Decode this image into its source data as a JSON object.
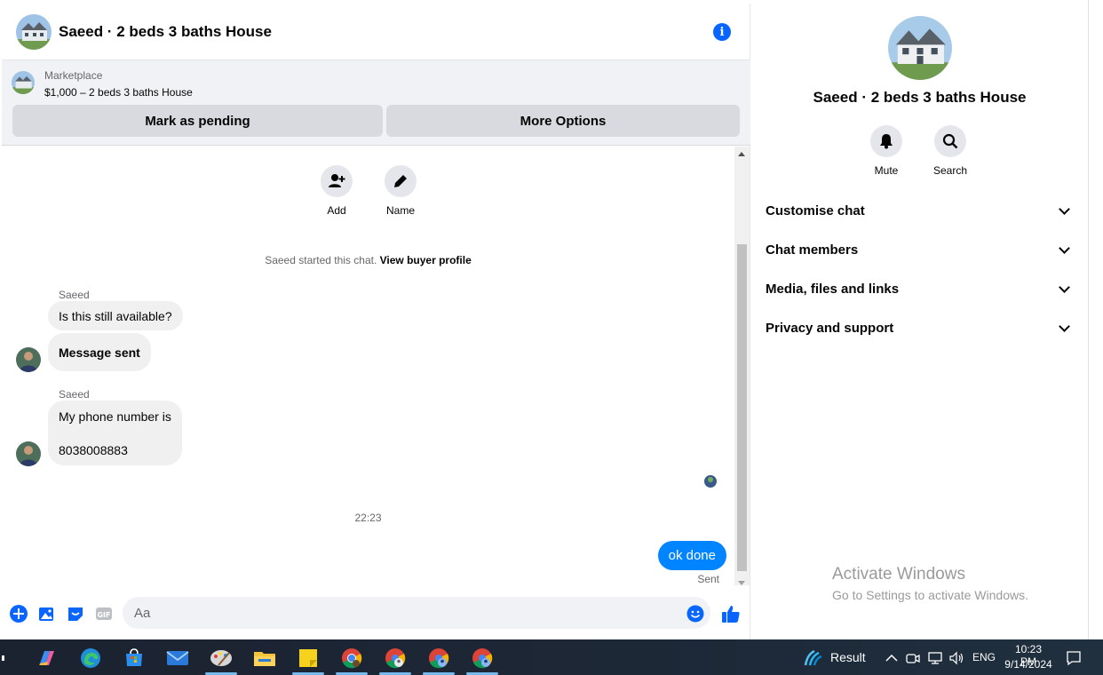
{
  "chat": {
    "title": "Saeed · 2 beds 3 baths House",
    "marketplace_label": "Marketplace",
    "listing": "$1,000 – 2 beds 3 baths House",
    "mark_pending": "Mark as pending",
    "more_options": "More Options",
    "actions": {
      "add": "Add",
      "name": "Name"
    },
    "started_text": "Saeed started this chat.",
    "view_buyer_profile": "View buyer profile",
    "messages": [
      {
        "sender": "Saeed",
        "text": "Is this still available?"
      },
      {
        "text": "Message sent"
      },
      {
        "sender": "Saeed",
        "text_line1": "My phone number is",
        "text_line2": "8038008883"
      }
    ],
    "timestamp": "22:23",
    "outgoing": "ok done",
    "status": "Sent",
    "composer_placeholder": "Aa"
  },
  "details": {
    "title": "Saeed · 2 beds 3 baths House",
    "mute": "Mute",
    "search": "Search",
    "sections": [
      "Customise chat",
      "Chat members",
      "Media, files and links",
      "Privacy and support"
    ]
  },
  "watermark": {
    "line1": "Activate Windows",
    "line2": "Go to Settings to activate Windows."
  },
  "taskbar": {
    "weather_label": "Result",
    "language": "ENG",
    "time": "10:23 PM",
    "date": "9/14/2024"
  },
  "colors": {
    "accent": "#0084ff",
    "button_gray": "#d8dadf",
    "market_bg": "#f0f2f5",
    "bubble_in": "#f0f0f0",
    "taskbar_bg": "#1d2837"
  }
}
